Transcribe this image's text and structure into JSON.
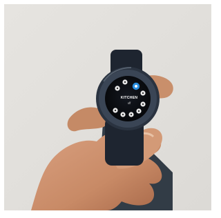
{
  "watch_screen": {
    "room": "KITCHEN",
    "state": "off"
  },
  "colors": {
    "wall": "#e3e1dd",
    "watch_bezel": "#2a3340",
    "screen": "#0b0d10",
    "accent_button": "#2b8fe0",
    "skin": "#c98f6b"
  },
  "icons": [
    "device-button-icon",
    "light-bulb-icon",
    "power-icon"
  ]
}
